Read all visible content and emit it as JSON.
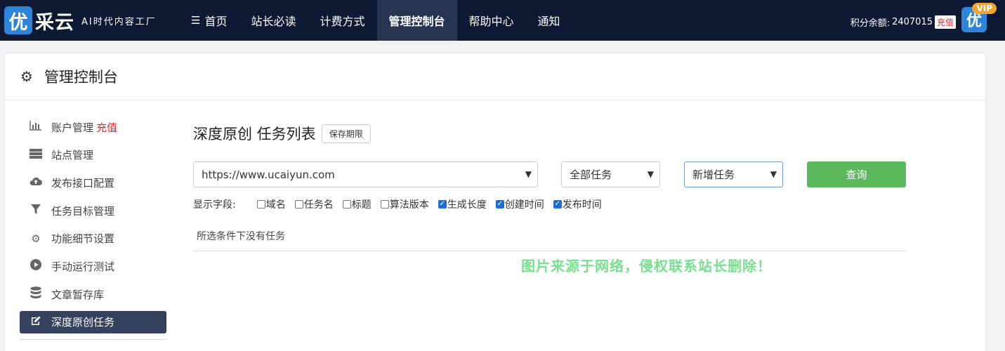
{
  "brand": {
    "badge": "优",
    "name": "采云",
    "tagline": "AI时代内容工厂"
  },
  "nav": {
    "items": [
      {
        "label": "首页",
        "icon": "list-icon"
      },
      {
        "label": "站长必读"
      },
      {
        "label": "计费方式"
      },
      {
        "label": "管理控制台",
        "active": true
      },
      {
        "label": "帮助中心"
      },
      {
        "label": "通知"
      }
    ]
  },
  "account": {
    "credit_label": "积分余额:",
    "credit_value": "2407015",
    "recharge": "充值",
    "avatar_text": "优",
    "vip": "VIP"
  },
  "panel": {
    "title": "管理控制台"
  },
  "sidebar": {
    "items": [
      {
        "label": "账户管理",
        "extra": "充值",
        "icon": "bar-chart-icon"
      },
      {
        "label": "站点管理",
        "icon": "server-icon"
      },
      {
        "label": "发布接口配置",
        "icon": "cloud-upload-icon"
      },
      {
        "label": "任务目标管理",
        "icon": "filter-icon"
      },
      {
        "label": "功能细节设置",
        "icon": "gears-icon"
      },
      {
        "label": "手动运行测试",
        "icon": "play-circle-icon"
      },
      {
        "label": "文章暂存库",
        "icon": "database-icon"
      },
      {
        "label": "深度原创任务",
        "icon": "edit-icon",
        "active": true
      }
    ]
  },
  "main": {
    "title": "深度原创 任务列表",
    "save_period": "保存期限",
    "site_select": "https://www.ucaiyun.com",
    "task_filter": "全部任务",
    "action_select": "新增任务",
    "query": "查询",
    "fields_label": "显示字段:",
    "fields": [
      {
        "label": "域名",
        "checked": false
      },
      {
        "label": "任务名",
        "checked": false
      },
      {
        "label": "标题",
        "checked": false
      },
      {
        "label": "算法版本",
        "checked": false
      },
      {
        "label": "生成长度",
        "checked": true
      },
      {
        "label": "创建时间",
        "checked": true
      },
      {
        "label": "发布时间",
        "checked": true
      }
    ],
    "empty_text": "所选条件下没有任务"
  },
  "watermark": "图片来源于网络，侵权联系站长删除！",
  "colors": {
    "navbar": "#0e1a33",
    "nav_active": "#253551",
    "sidebar_active": "#34425e",
    "query_button": "#5cb85c",
    "recharge_red": "#e0272b",
    "watermark": "#5fdc7a"
  }
}
